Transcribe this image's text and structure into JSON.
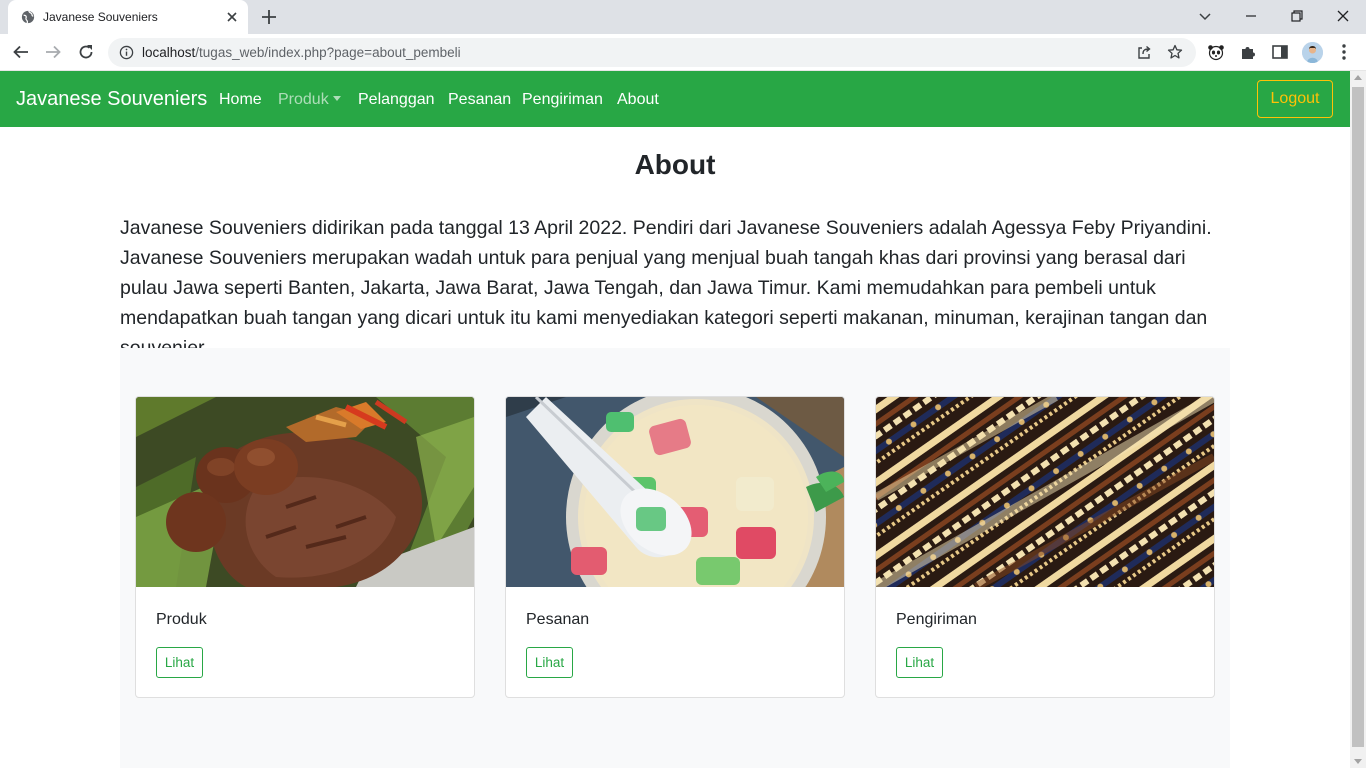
{
  "browser": {
    "tab_title": "Javanese Souveniers",
    "url_host": "localhost",
    "url_path": "/tugas_web/index.php?page=about_pembeli"
  },
  "colors": {
    "navbar": "#28a745",
    "logout_border": "#ffc107",
    "button_outline": "#28a745"
  },
  "navbar": {
    "brand": "Javanese Souveniers",
    "links": [
      "Home",
      "Produk",
      "Pelanggan",
      "Pesanan",
      "Pengiriman",
      "About"
    ],
    "logout": "Logout"
  },
  "page": {
    "title": "About",
    "description": "Javanese Souveniers didirikan pada tanggal 13 April 2022. Pendiri dari Javanese Souveniers adalah Agessya Feby Priyandini. Javanese Souveniers merupakan wadah untuk para penjual yang menjual buah tangah khas dari provinsi yang berasal dari pulau Jawa seperti Banten, Jakarta, Jawa Barat, Jawa Tengah, dan Jawa Timur. Kami memudahkan para pembeli untuk mendapatkan buah tangan yang dicari untuk itu kami menyediakan kategori seperti makanan, minuman, kerajinan tangan dan souvenier."
  },
  "cards": [
    {
      "title": "Produk",
      "button": "Lihat",
      "image": "gudeg-food-photo"
    },
    {
      "title": "Pesanan",
      "button": "Lihat",
      "image": "es-dawet-drink-photo"
    },
    {
      "title": "Pengiriman",
      "button": "Lihat",
      "image": "batik-fabric-photo"
    }
  ]
}
